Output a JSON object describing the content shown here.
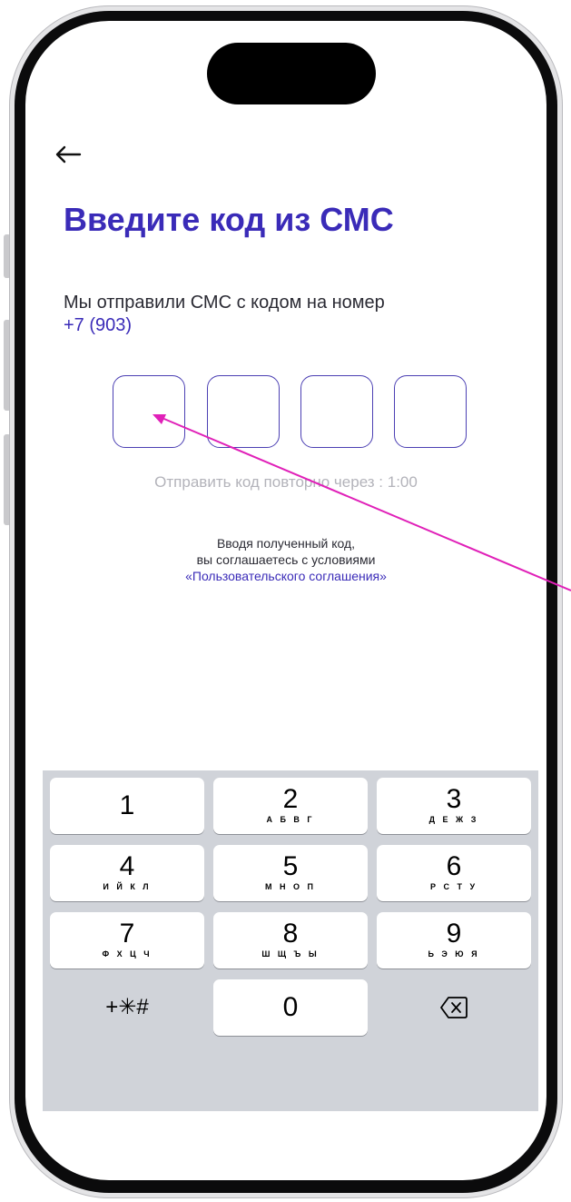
{
  "header": {
    "back_icon": "arrow-left-icon",
    "title": "Введите код из СМС",
    "subtitle": "Мы отправили СМС с кодом на номер",
    "phone_number": "+7 (903)"
  },
  "code_input": {
    "length": 4,
    "values": [
      "",
      "",
      "",
      ""
    ]
  },
  "resend": {
    "text": "Отправить код повторно через : 1:00"
  },
  "agreement": {
    "line1": "Вводя полученный код,",
    "line2": "вы соглашаетесь с условиями",
    "link": "«Пользовательского соглашения»"
  },
  "keyboard": {
    "keys": [
      {
        "digit": "1",
        "letters": ""
      },
      {
        "digit": "2",
        "letters": "А Б В Г"
      },
      {
        "digit": "3",
        "letters": "Д Е Ж З"
      },
      {
        "digit": "4",
        "letters": "И Й К Л"
      },
      {
        "digit": "5",
        "letters": "М Н О П"
      },
      {
        "digit": "6",
        "letters": "Р С Т У"
      },
      {
        "digit": "7",
        "letters": "Ф Х Ц Ч"
      },
      {
        "digit": "8",
        "letters": "Ш Щ Ъ Ы"
      },
      {
        "digit": "9",
        "letters": "Ь Э Ю Я"
      }
    ],
    "symbols_label": "+✳#",
    "zero": "0",
    "backspace_icon": "backspace-icon"
  },
  "colors": {
    "accent": "#3a2bb8",
    "annotation": "#e020b8",
    "keyboard_bg": "#d0d3d9"
  }
}
